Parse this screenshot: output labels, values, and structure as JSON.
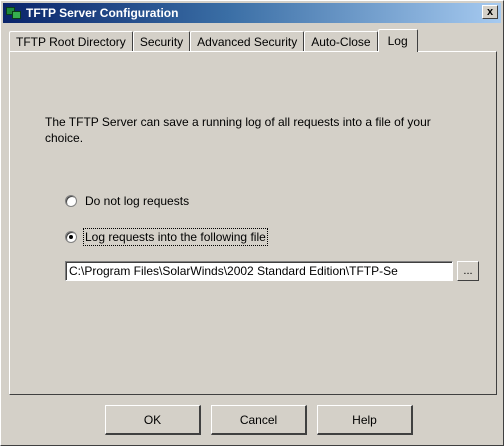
{
  "window": {
    "title": "TFTP Server Configuration",
    "close_label": "x"
  },
  "tabs": [
    {
      "label": "TFTP Root Directory",
      "active": false
    },
    {
      "label": "Security",
      "active": false
    },
    {
      "label": "Advanced Security",
      "active": false
    },
    {
      "label": "Auto-Close",
      "active": false
    },
    {
      "label": "Log",
      "active": true
    }
  ],
  "log": {
    "description": "The TFTP Server can save a running log of all requests into a file of your choice.",
    "options": [
      {
        "label": "Do not log requests",
        "checked": false
      },
      {
        "label": "Log requests into the following file",
        "checked": true
      }
    ],
    "file_path": "C:\\Program Files\\SolarWinds\\2002 Standard Edition\\TFTP-Se",
    "browse_label": "..."
  },
  "buttons": {
    "ok": "OK",
    "cancel": "Cancel",
    "help": "Help"
  },
  "icons": {
    "title": "tftp-app-icon"
  }
}
